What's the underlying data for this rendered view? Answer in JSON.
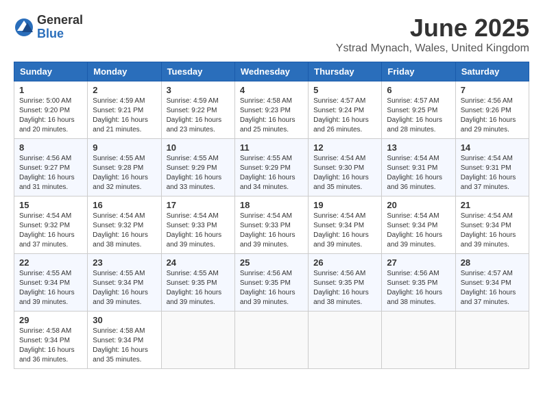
{
  "logo": {
    "general": "General",
    "blue": "Blue"
  },
  "title": {
    "month_year": "June 2025",
    "location": "Ystrad Mynach, Wales, United Kingdom"
  },
  "headers": [
    "Sunday",
    "Monday",
    "Tuesday",
    "Wednesday",
    "Thursday",
    "Friday",
    "Saturday"
  ],
  "weeks": [
    [
      {
        "day": "1",
        "info": "Sunrise: 5:00 AM\nSunset: 9:20 PM\nDaylight: 16 hours\nand 20 minutes."
      },
      {
        "day": "2",
        "info": "Sunrise: 4:59 AM\nSunset: 9:21 PM\nDaylight: 16 hours\nand 21 minutes."
      },
      {
        "day": "3",
        "info": "Sunrise: 4:59 AM\nSunset: 9:22 PM\nDaylight: 16 hours\nand 23 minutes."
      },
      {
        "day": "4",
        "info": "Sunrise: 4:58 AM\nSunset: 9:23 PM\nDaylight: 16 hours\nand 25 minutes."
      },
      {
        "day": "5",
        "info": "Sunrise: 4:57 AM\nSunset: 9:24 PM\nDaylight: 16 hours\nand 26 minutes."
      },
      {
        "day": "6",
        "info": "Sunrise: 4:57 AM\nSunset: 9:25 PM\nDaylight: 16 hours\nand 28 minutes."
      },
      {
        "day": "7",
        "info": "Sunrise: 4:56 AM\nSunset: 9:26 PM\nDaylight: 16 hours\nand 29 minutes."
      }
    ],
    [
      {
        "day": "8",
        "info": "Sunrise: 4:56 AM\nSunset: 9:27 PM\nDaylight: 16 hours\nand 31 minutes."
      },
      {
        "day": "9",
        "info": "Sunrise: 4:55 AM\nSunset: 9:28 PM\nDaylight: 16 hours\nand 32 minutes."
      },
      {
        "day": "10",
        "info": "Sunrise: 4:55 AM\nSunset: 9:29 PM\nDaylight: 16 hours\nand 33 minutes."
      },
      {
        "day": "11",
        "info": "Sunrise: 4:55 AM\nSunset: 9:29 PM\nDaylight: 16 hours\nand 34 minutes."
      },
      {
        "day": "12",
        "info": "Sunrise: 4:54 AM\nSunset: 9:30 PM\nDaylight: 16 hours\nand 35 minutes."
      },
      {
        "day": "13",
        "info": "Sunrise: 4:54 AM\nSunset: 9:31 PM\nDaylight: 16 hours\nand 36 minutes."
      },
      {
        "day": "14",
        "info": "Sunrise: 4:54 AM\nSunset: 9:31 PM\nDaylight: 16 hours\nand 37 minutes."
      }
    ],
    [
      {
        "day": "15",
        "info": "Sunrise: 4:54 AM\nSunset: 9:32 PM\nDaylight: 16 hours\nand 37 minutes."
      },
      {
        "day": "16",
        "info": "Sunrise: 4:54 AM\nSunset: 9:32 PM\nDaylight: 16 hours\nand 38 minutes."
      },
      {
        "day": "17",
        "info": "Sunrise: 4:54 AM\nSunset: 9:33 PM\nDaylight: 16 hours\nand 39 minutes."
      },
      {
        "day": "18",
        "info": "Sunrise: 4:54 AM\nSunset: 9:33 PM\nDaylight: 16 hours\nand 39 minutes."
      },
      {
        "day": "19",
        "info": "Sunrise: 4:54 AM\nSunset: 9:34 PM\nDaylight: 16 hours\nand 39 minutes."
      },
      {
        "day": "20",
        "info": "Sunrise: 4:54 AM\nSunset: 9:34 PM\nDaylight: 16 hours\nand 39 minutes."
      },
      {
        "day": "21",
        "info": "Sunrise: 4:54 AM\nSunset: 9:34 PM\nDaylight: 16 hours\nand 39 minutes."
      }
    ],
    [
      {
        "day": "22",
        "info": "Sunrise: 4:55 AM\nSunset: 9:34 PM\nDaylight: 16 hours\nand 39 minutes."
      },
      {
        "day": "23",
        "info": "Sunrise: 4:55 AM\nSunset: 9:34 PM\nDaylight: 16 hours\nand 39 minutes."
      },
      {
        "day": "24",
        "info": "Sunrise: 4:55 AM\nSunset: 9:35 PM\nDaylight: 16 hours\nand 39 minutes."
      },
      {
        "day": "25",
        "info": "Sunrise: 4:56 AM\nSunset: 9:35 PM\nDaylight: 16 hours\nand 39 minutes."
      },
      {
        "day": "26",
        "info": "Sunrise: 4:56 AM\nSunset: 9:35 PM\nDaylight: 16 hours\nand 38 minutes."
      },
      {
        "day": "27",
        "info": "Sunrise: 4:56 AM\nSunset: 9:35 PM\nDaylight: 16 hours\nand 38 minutes."
      },
      {
        "day": "28",
        "info": "Sunrise: 4:57 AM\nSunset: 9:34 PM\nDaylight: 16 hours\nand 37 minutes."
      }
    ],
    [
      {
        "day": "29",
        "info": "Sunrise: 4:58 AM\nSunset: 9:34 PM\nDaylight: 16 hours\nand 36 minutes."
      },
      {
        "day": "30",
        "info": "Sunrise: 4:58 AM\nSunset: 9:34 PM\nDaylight: 16 hours\nand 35 minutes."
      },
      {
        "day": "",
        "info": ""
      },
      {
        "day": "",
        "info": ""
      },
      {
        "day": "",
        "info": ""
      },
      {
        "day": "",
        "info": ""
      },
      {
        "day": "",
        "info": ""
      }
    ]
  ]
}
